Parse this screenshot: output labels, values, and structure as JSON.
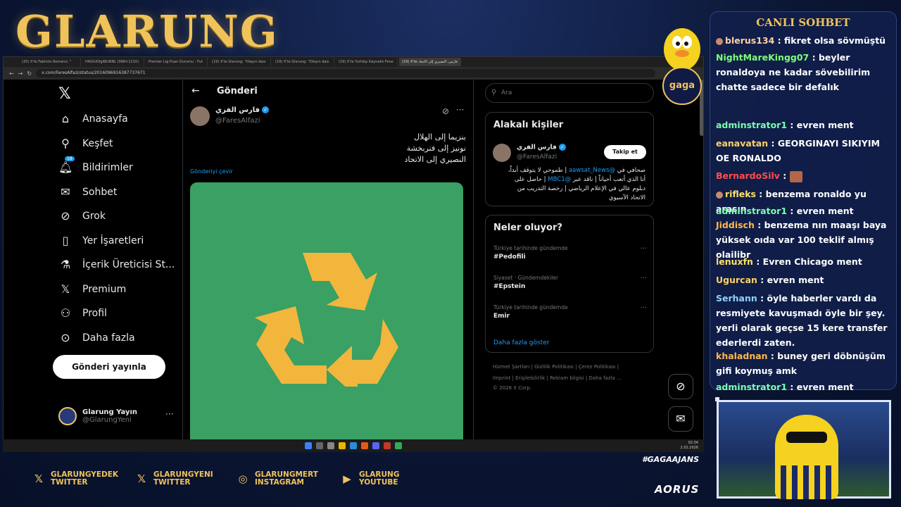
{
  "brand": "GLARUNG",
  "browser": {
    "tabs": [
      "(20) X'te Fabrizio Romano: \"",
      "HAGIUOlgAEzNNL (998×1210)",
      "Premier Lig Puan Durumu - Fut",
      "(19) X'te Glarung: \"Olayın dası",
      "(19) X'te Glarung: \"Olayın dası",
      "(19) X'te Yurtdışı Kaynaklı Fene",
      "(19) X'te فارس: النصيري إلى الاتحاد"
    ],
    "url": "x.com/FaresAlfazi/status/2016096916387737671"
  },
  "sidebar": {
    "items": [
      {
        "label": "Anasayfa",
        "icon": "home-icon"
      },
      {
        "label": "Keşfet",
        "icon": "search-icon"
      },
      {
        "label": "Bildirimler",
        "icon": "bell-icon",
        "badge": "18"
      },
      {
        "label": "Sohbet",
        "icon": "mail-icon"
      },
      {
        "label": "Grok",
        "icon": "grok-icon"
      },
      {
        "label": "Yer İşaretleri",
        "icon": "bookmark-icon"
      },
      {
        "label": "İçerik Üreticisi St...",
        "icon": "flask-icon"
      },
      {
        "label": "Premium",
        "icon": "x-icon"
      },
      {
        "label": "Profil",
        "icon": "person-icon"
      },
      {
        "label": "Daha fazla",
        "icon": "more-circle-icon"
      }
    ],
    "post_button": "Gönderi yayınla",
    "me_name": "Glarung Yayın",
    "me_handle": "@GlarungYeni"
  },
  "post": {
    "header": "Gönderi",
    "author_name": "فارس الفزي",
    "author_handle": "@FaresAlfazi",
    "lines": [
      "بنزيما إلى الهلال",
      "نونيز إلى فنربخشة",
      "النصيري إلى الاتحاد"
    ],
    "translate": "Gönderiyi çevir"
  },
  "right": {
    "search_placeholder": "Ara",
    "related_title": "Alakalı kişiler",
    "related_name": "فارس الفزي",
    "related_handle": "@FaresAlfazi",
    "follow": "Takip et",
    "bio_link1": "@aawsat_News",
    "bio_1": "صحافي في",
    "bio_2": "| طموحي لا يتوقف أبداً، أنا الذي أتعب أحياناً | ناقد عبر",
    "bio_link2": "@MBC1",
    "bio_3": "| حاصل على دبلوم عالي في الإعلام الرياضي | رخصة التدريب من الاتحاد الآسيوي",
    "trends_title": "Neler oluyor?",
    "trends": [
      {
        "cat": "Türkiye tarihinde gündemde",
        "name": "#Pedofili"
      },
      {
        "cat": "Siyaset · Gündemdekiler",
        "name": "#Epstein"
      },
      {
        "cat": "Türkiye tarihinde gündemde",
        "name": "Emir"
      }
    ],
    "show_more": "Daha fazla göster",
    "footer1": "Hizmet Şartları  |  Gizlilik Politikası  |  Çerez Politikası  |",
    "footer2": "Imprint  |  Erişilebilirlik  |  Reklam bilgisi  |  Daha fazla ...",
    "footer3": "© 2026 X Corp."
  },
  "tray": {
    "time": "02:34",
    "date": "2.02.2026"
  },
  "chat": {
    "title": "CANLI SOHBET",
    "messages": [
      {
        "user": "blerus134",
        "color": "#ffd1a6",
        "text": " : fikret olsa sövmüştü",
        "dot": true
      },
      {
        "user": "NightMareKingg07",
        "color": "#7dff7a",
        "text": " : beyler ronaldoya ne kadar sövebilirim chatte sadece bir defalık"
      },
      {
        "user": "adminstrator1",
        "color": "#7dffb0",
        "text": " : evren ment"
      },
      {
        "user": "eanavatan",
        "color": "#ffd166",
        "text": " : GEORGINAYI SIKIYIM OE RONALDO"
      },
      {
        "user": "BernardoSilv",
        "color": "#ff4d4d",
        "text": " : ",
        "emote": true
      },
      {
        "user": "rifleks",
        "color": "#ffe066",
        "text": " : benzema ronaldo yu arasın",
        "dot": true
      },
      {
        "user": "adminstrator1",
        "color": "#7dffb0",
        "text": " : evren ment"
      },
      {
        "user": "Jiddisch",
        "color": "#ffb84d",
        "text": " : benzema nın maaşı baya yüksek oıda var 100 teklif almış olailibr"
      },
      {
        "user": "lenuxfn",
        "color": "#ffe066",
        "text": " : Evren Chicago ment"
      },
      {
        "user": "Ugurcan",
        "color": "#ffd166",
        "text": " : evren ment"
      },
      {
        "user": "Serhann",
        "color": "#8fd3ff",
        "text": " : öyle haberler vardı da resmiyete kavuşmadı öyle bir şey. yerli olarak geçse 15 kere transfer ederlerdi zaten."
      },
      {
        "user": "khaladnan",
        "color": "#ffb84d",
        "text": " : buney geri döbnüşüm gifi koymuş amk"
      },
      {
        "user": "adminstrator1",
        "color": "#7dffb0",
        "text": " : evren ment"
      }
    ]
  },
  "overlay": {
    "badge": "gaga",
    "hashtag": "#GAGAAJANS",
    "sponsor": "AORUS",
    "socials": [
      {
        "icon": "x-icon",
        "line1": "GLARUNGYEDEK",
        "line2": "TWITTER"
      },
      {
        "icon": "x-icon",
        "line1": "GLARUNGYENI",
        "line2": "TWITTER"
      },
      {
        "icon": "instagram-icon",
        "line1": "GLARUNGMERT",
        "line2": "INSTAGRAM"
      },
      {
        "icon": "youtube-icon",
        "line1": "GLARUNG",
        "line2": "YOUTUBE"
      }
    ]
  }
}
